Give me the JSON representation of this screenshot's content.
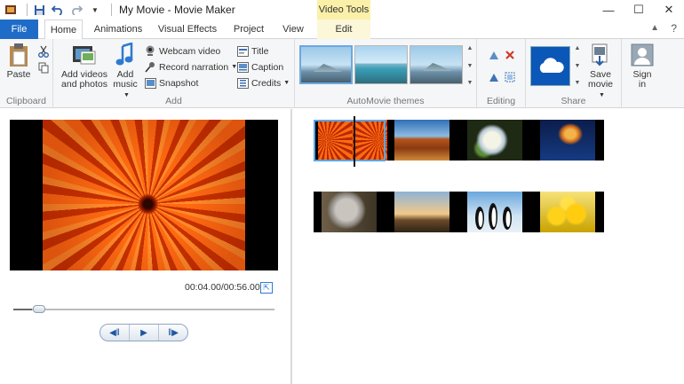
{
  "titlebar": {
    "title": "My Movie - Movie Maker",
    "context_tab": "Video Tools",
    "minimize": "—",
    "maximize": "☐",
    "close": "✕"
  },
  "tabs": [
    {
      "label": "File"
    },
    {
      "label": "Home"
    },
    {
      "label": "Animations"
    },
    {
      "label": "Visual Effects"
    },
    {
      "label": "Project"
    },
    {
      "label": "View"
    },
    {
      "label": "Edit"
    }
  ],
  "ribbon": {
    "clipboard": {
      "label": "Clipboard",
      "paste": "Paste"
    },
    "add": {
      "label": "Add",
      "add_videos_line1": "Add videos",
      "add_videos_line2": "and photos",
      "add_music_line1": "Add",
      "add_music_line2": "music",
      "webcam": "Webcam video",
      "record": "Record narration",
      "snapshot": "Snapshot",
      "title": "Title",
      "caption": "Caption",
      "credits": "Credits"
    },
    "themes": {
      "label": "AutoMovie themes"
    },
    "editing": {
      "label": "Editing"
    },
    "share": {
      "label": "Share",
      "save_line1": "Save",
      "save_line2": "movie"
    },
    "signin": {
      "line1": "Sign",
      "line2": "in"
    }
  },
  "preview": {
    "timecode": "00:04.00/00:56.00",
    "progress": 0.0714
  },
  "colors": {
    "accent": "#1f6cc8",
    "context_tab": "#fbf0a8",
    "selection": "#58a6e6"
  }
}
